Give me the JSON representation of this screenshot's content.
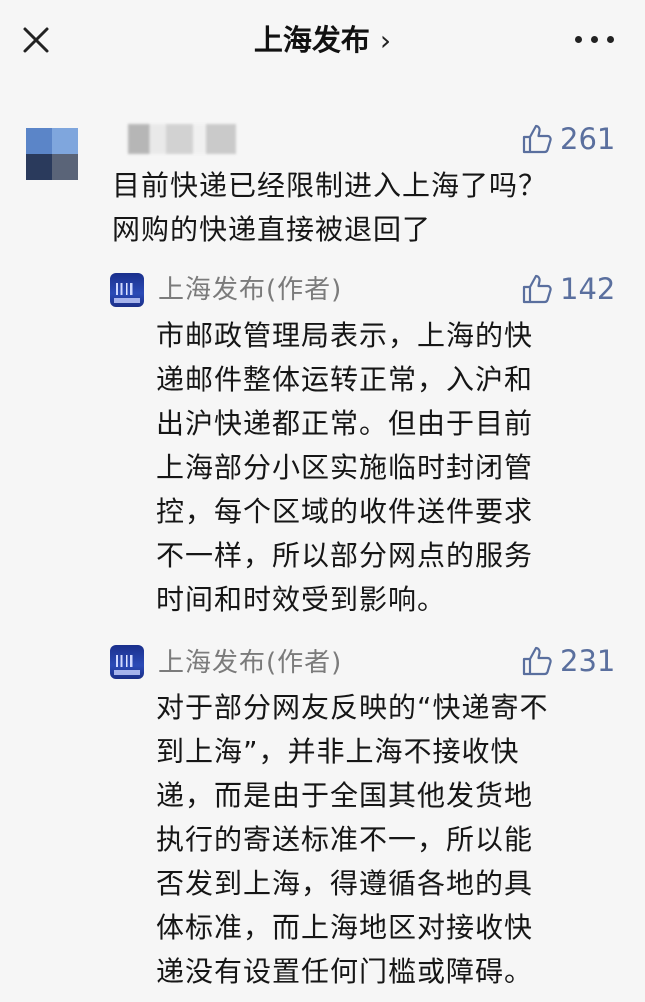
{
  "header": {
    "title": "上海发布",
    "chevron": "›"
  },
  "comment": {
    "likes": "261",
    "text": "目前快递已经限制进入上海了吗？\n网购的快递直接被退回了"
  },
  "replies": [
    {
      "author": "上海发布(作者)",
      "likes": "142",
      "text": "市邮政管理局表示，上海的快\n递邮件整体运转正常，入沪和\n出沪快递都正常。但由于目前\n上海部分小区实施临时封闭管\n控，每个区域的收件送件要求\n不一样，所以部分网点的服务\n时间和时效受到影响。"
    },
    {
      "author": "上海发布(作者)",
      "likes": "231",
      "text": "对于部分网友反映的“快递寄不\n到上海”，并非上海不接收快\n递，而是由于全国其他发货地\n执行的寄送标准不一，所以能\n否发到上海，得遵循各地的具\n体标准，而上海地区对接收快\n递没有设置任何门槛或障碍。"
    }
  ],
  "colors": {
    "like": "#5a6f9e",
    "background": "#f6f6f6"
  }
}
